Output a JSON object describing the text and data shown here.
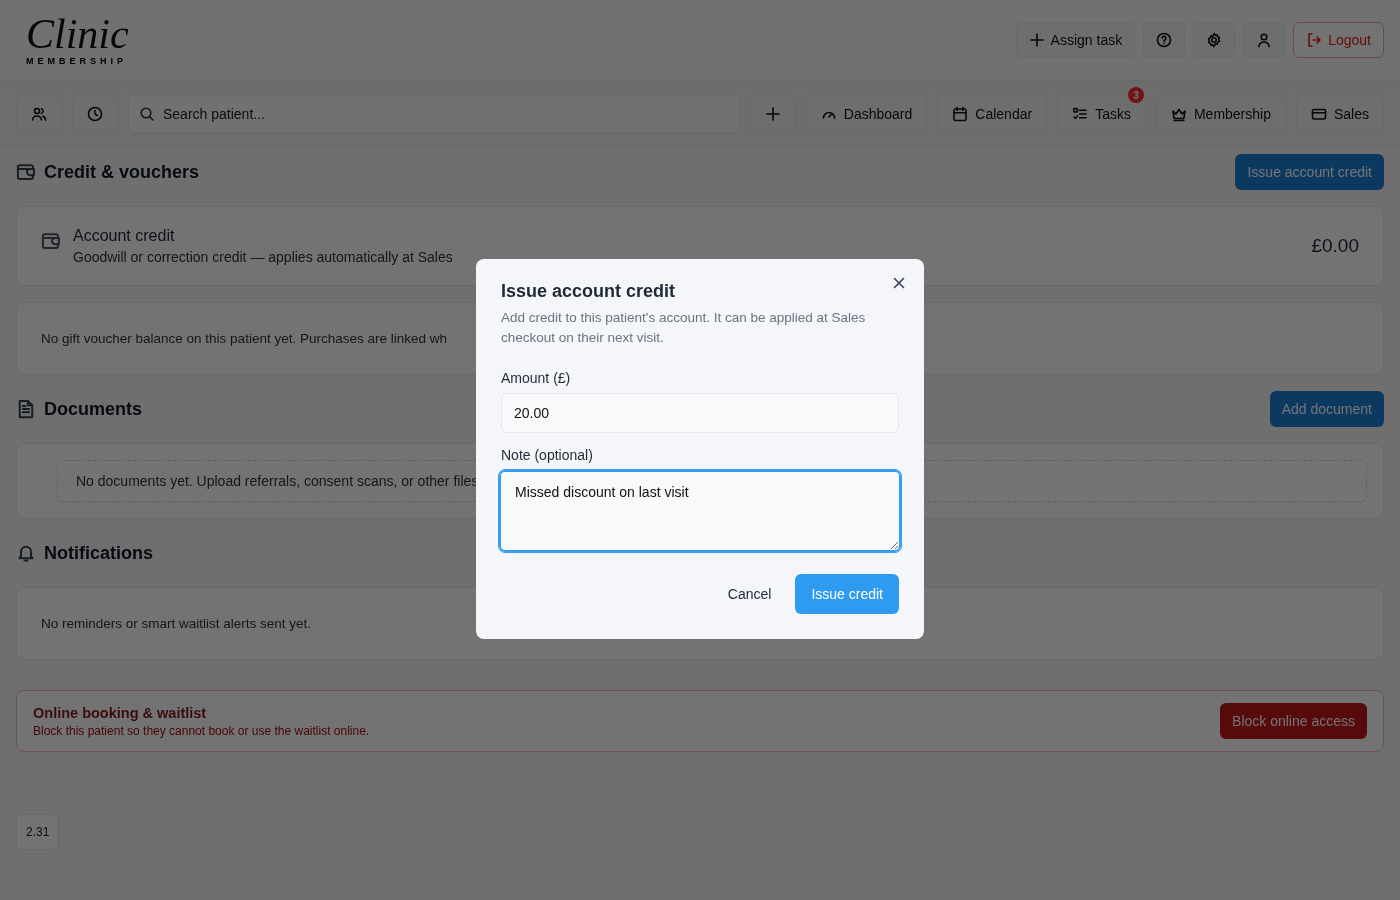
{
  "logo": {
    "script": "Clinic",
    "tagline": "MEMBERSHIP"
  },
  "header_actions": [
    {
      "kind": "add",
      "label": "Assign task"
    },
    {
      "kind": "help"
    },
    {
      "kind": "settings"
    },
    {
      "kind": "account"
    },
    {
      "kind": "logout",
      "label": "Logout"
    }
  ],
  "toolbar": {
    "quick_buttons": [
      {
        "kind": "people"
      },
      {
        "kind": "history"
      }
    ],
    "search": {
      "placeholder": "Search patient..."
    },
    "nav": [
      {
        "kind": "add"
      },
      {
        "kind": "gauge",
        "label": "Dashboard"
      },
      {
        "kind": "calendar",
        "label": "Calendar"
      },
      {
        "kind": "tasks",
        "label": "Tasks",
        "badge": "3"
      },
      {
        "kind": "crown",
        "label": "Membership"
      },
      {
        "kind": "card",
        "label": "Sales"
      }
    ]
  },
  "sections": [
    {
      "kind": "wallet",
      "title": "Credit & vouchers",
      "action": "Issue account credit",
      "cards": [
        {
          "kind": "balance",
          "title": "Account credit",
          "text": "Goodwill or correction credit — applies automatically at Sales",
          "amount": "£0.00"
        },
        {
          "kind": "note",
          "text": "No gift voucher balance on this patient yet. Purchases are linked wh"
        }
      ]
    },
    {
      "kind": "document",
      "title": "Documents",
      "action": "Add document",
      "cards": [
        {
          "kind": "empty",
          "text": "No documents yet. Upload referrals, consent scans, or other files"
        }
      ]
    },
    {
      "kind": "bell",
      "title": "Notifications",
      "cards": [
        {
          "kind": "note",
          "text": "No reminders or smart waitlist alerts sent yet."
        }
      ]
    }
  ],
  "danger": {
    "title": "Online booking & waitlist",
    "text": "Block this patient so they cannot book or use the waitlist online.",
    "action": "Block online access"
  },
  "version": "2.31",
  "dialog": {
    "title": "Issue account credit",
    "description": "Add credit to this patient's account. It can be applied at Sales checkout on their next visit.",
    "fields": [
      {
        "kind": "input",
        "label": "Amount (£)",
        "value": "20.00",
        "focused": false
      },
      {
        "kind": "textarea",
        "label": "Note (optional)",
        "value": "Missed discount on last visit",
        "focused": true
      }
    ],
    "buttons": [
      {
        "kind": "secondary",
        "label": "Cancel"
      },
      {
        "kind": "primary",
        "label": "Issue credit"
      }
    ]
  }
}
